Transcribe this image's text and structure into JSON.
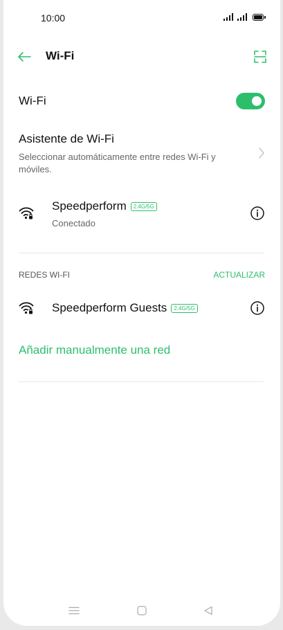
{
  "status_bar": {
    "time": "10:00"
  },
  "header": {
    "back_icon": "arrow-left-icon",
    "title": "Wi-Fi",
    "scan_icon": "qr-scan-icon"
  },
  "wifi_toggle": {
    "label": "Wi-Fi",
    "enabled": true
  },
  "assistant": {
    "title": "Asistente de Wi-Fi",
    "description": "Seleccionar automáticamente entre redes Wi-Fi y móviles."
  },
  "connected_network": {
    "name": "Speedperform",
    "band": "2.4G/5G",
    "status": "Conectado"
  },
  "networks_section": {
    "label": "REDES WI-FI",
    "refresh_label": "ACTUALIZAR"
  },
  "networks": [
    {
      "name": "Speedperform Guests",
      "band": "2.4G/5G"
    }
  ],
  "add_network_label": "Añadir manualmente una red",
  "colors": {
    "accent": "#2dbe6c"
  }
}
